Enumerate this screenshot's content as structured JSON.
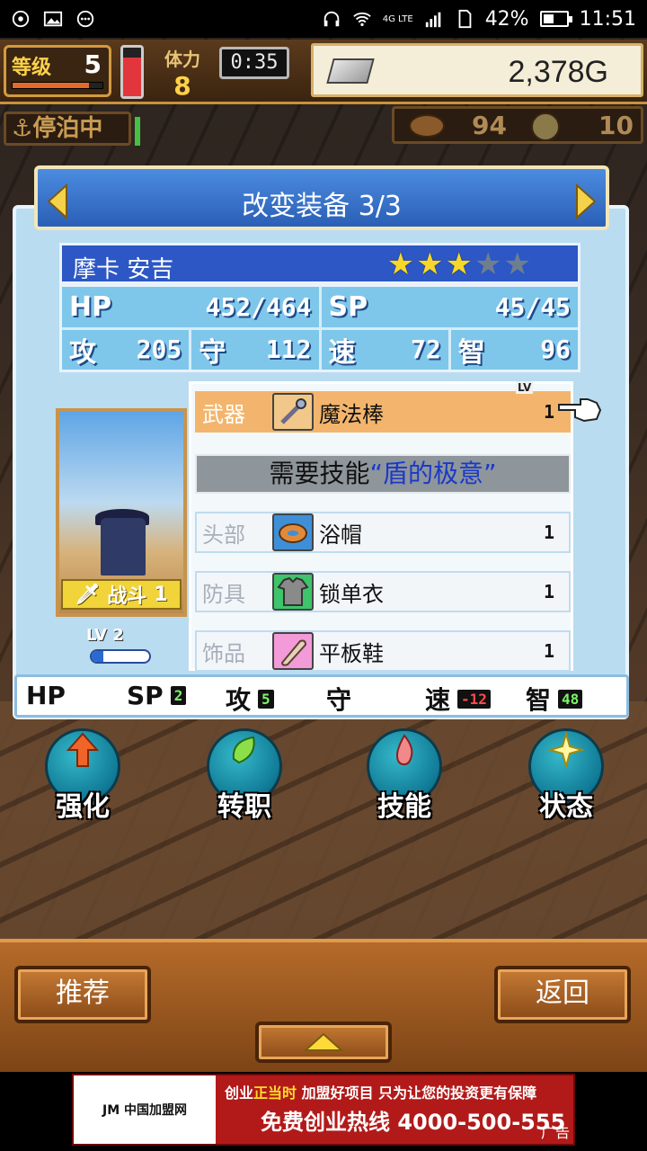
{
  "status_bar": {
    "battery": "42%",
    "time": "11:51",
    "network": "4G LTE"
  },
  "hud": {
    "level_label": "等级",
    "level": "5",
    "level_progress": 0.85,
    "hp_fill": 0.8,
    "stamina_label": "体力",
    "stamina": "8",
    "timer": "0:35",
    "gold": "2,378G",
    "mooring": "停泊中",
    "resource1": "94",
    "resource2": "10"
  },
  "panel": {
    "title": "改变装备 3/3",
    "character_name": "摩卡 安吉",
    "stars_filled": 3,
    "stars_total": 5,
    "stats": {
      "hp_label": "HP",
      "hp_value": "452/464",
      "sp_label": "SP",
      "sp_value": "45/45",
      "atk_label": "攻",
      "atk_value": "205",
      "def_label": "守",
      "def_value": "112",
      "spd_label": "速",
      "spd_value": "72",
      "int_label": "智",
      "int_value": "96"
    },
    "portrait": {
      "battle_tag": "战斗",
      "battle_count": "1",
      "lv_label": "LV",
      "lv": "2",
      "exp_progress": 0.2
    },
    "lv_header": "LV",
    "equipment": [
      {
        "slot": "武器",
        "name": "魔法棒",
        "lv": "1",
        "icon": "wand-icon",
        "selected": true
      },
      {
        "slot": "头部",
        "name": "浴帽",
        "lv": "1",
        "icon": "bath-cap-icon",
        "selected": false
      },
      {
        "slot": "防具",
        "name": "锁单衣",
        "lv": "1",
        "icon": "chain-shirt-icon",
        "selected": false
      },
      {
        "slot": "饰品",
        "name": "平板鞋",
        "lv": "1",
        "icon": "flat-shoe-icon",
        "selected": false
      }
    ],
    "skill_requirement": {
      "prefix": "需要技能",
      "skill": "“盾的极意”"
    },
    "diff": {
      "hp_label": "HP",
      "sp_label": "SP",
      "sp_value": "2",
      "atk_label": "攻",
      "atk_value": "5",
      "def_label": "守",
      "spd_label": "速",
      "spd_value": "-12",
      "int_label": "智",
      "int_value": "48"
    }
  },
  "actions": [
    {
      "label": "强化",
      "icon": "upgrade-arrow-icon"
    },
    {
      "label": "转职",
      "icon": "job-change-icon"
    },
    {
      "label": "技能",
      "icon": "fire-skill-icon"
    },
    {
      "label": "状态",
      "icon": "sparkle-status-icon"
    }
  ],
  "bottom": {
    "recommend_label": "推荐",
    "back_label": "返回"
  },
  "ad": {
    "logo": "JM 中国加盟网",
    "line1_a": "创业",
    "line1_b": "正当时",
    "line1_c": " 加盟好项目 只为让您的投资更有保障",
    "line2": "免费创业热线 4000-500-555",
    "tag": "广告"
  },
  "colors": {
    "panel_bg": "#b9dcf0",
    "title_bar": "#2a5fb6",
    "selected_row": "#f3b56d",
    "skill_text": "#1a39c9",
    "star_on": "#f9d72a"
  }
}
